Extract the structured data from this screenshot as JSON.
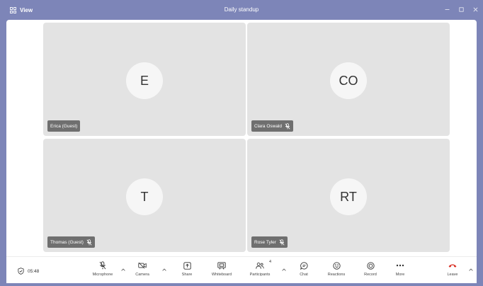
{
  "titlebar": {
    "view_label": "View",
    "meeting_title": "Daily standup"
  },
  "participants": [
    {
      "initials": "E",
      "name": "Erica (Guest)",
      "muted": false
    },
    {
      "initials": "CO",
      "name": "Clara Oswald",
      "muted": true
    },
    {
      "initials": "T",
      "name": "Thomas (Guest)",
      "muted": true
    },
    {
      "initials": "RT",
      "name": "Rose Tyler",
      "muted": true
    }
  ],
  "toolbar": {
    "timer": "05:48",
    "microphone": "Microphone",
    "camera": "Camera",
    "share": "Share",
    "whiteboard": "Whiteboard",
    "participants": "Participants",
    "participants_count": "4",
    "chat": "Chat",
    "reactions": "Reactions",
    "record": "Record",
    "more": "More",
    "leave": "Leave"
  },
  "colors": {
    "titlebar": "#7d85b8",
    "tile": "#e3e3e3",
    "nametag": "#6f6f6f",
    "leave": "#d93025"
  }
}
